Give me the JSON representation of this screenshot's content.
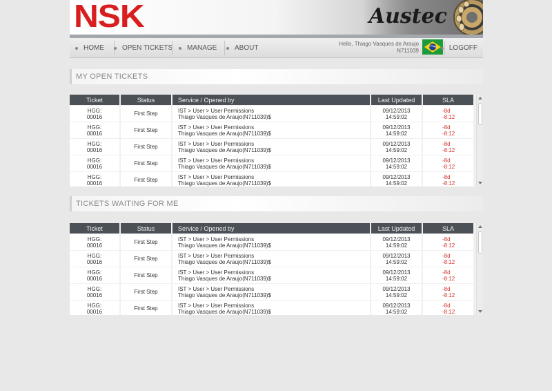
{
  "header": {
    "logo_text": "NSK",
    "brand_text": "Austec"
  },
  "nav": {
    "items": [
      {
        "label": "HOME"
      },
      {
        "label": "OPEN TICKETS"
      },
      {
        "label": "MANAGE"
      },
      {
        "label": "ABOUT"
      }
    ],
    "user_greeting": "Hello, Thiago Vasques de Araujo",
    "user_id": "N711039",
    "logoff_label": "LOGOFF"
  },
  "sections": [
    {
      "title": "MY OPEN TICKETS",
      "columns": [
        "Ticket",
        "Status",
        "Service / Opened by",
        "Last Updated",
        "SLA"
      ],
      "rows": [
        {
          "ticket_a": "HGG:",
          "ticket_b": "00016",
          "status": "First Step",
          "service": "IST > User > User Permissions",
          "opened_by": "Thiago Vasques de Araujo(N711039)$",
          "date": "09/12/2013",
          "time": "14:59:02",
          "sla_a": "-8d",
          "sla_b": "-8:12"
        },
        {
          "ticket_a": "HGG:",
          "ticket_b": "00016",
          "status": "First Step",
          "service": "IST > User > User Permissions",
          "opened_by": "Thiago Vasques de Araujo(N711039)$",
          "date": "09/12/2013",
          "time": "14:59:02",
          "sla_a": "-8d",
          "sla_b": "-8:12"
        },
        {
          "ticket_a": "HGG:",
          "ticket_b": "00016",
          "status": "First Step",
          "service": "IST > User > User Permissions",
          "opened_by": "Thiago Vasques de Araujo(N711039)$",
          "date": "09/12/2013",
          "time": "14:59:02",
          "sla_a": "-8d",
          "sla_b": "-8:12"
        },
        {
          "ticket_a": "HGG:",
          "ticket_b": "00016",
          "status": "First Step",
          "service": "IST > User > User Permissions",
          "opened_by": "Thiago Vasques de Araujo(N711039)$",
          "date": "09/12/2013",
          "time": "14:59:02",
          "sla_a": "-8d",
          "sla_b": "-8:12"
        },
        {
          "ticket_a": "HGG:",
          "ticket_b": "00016",
          "status": "First Step",
          "service": "IST > User > User Permissions",
          "opened_by": "Thiago Vasques de Araujo(N711039)$",
          "date": "09/12/2013",
          "time": "14:59:02",
          "sla_a": "-8d",
          "sla_b": "-8:12"
        }
      ]
    },
    {
      "title": "TICKETS WAITING FOR ME",
      "columns": [
        "Ticket",
        "Status",
        "Service / Opened by",
        "Last Updated",
        "SLA"
      ],
      "rows": [
        {
          "ticket_a": "HGG:",
          "ticket_b": "00016",
          "status": "First Step",
          "service": "IST > User > User Permissions",
          "opened_by": "Thiago Vasques de Araujo(N711039)$",
          "date": "09/12/2013",
          "time": "14:59:02",
          "sla_a": "-8d",
          "sla_b": "-8:12"
        },
        {
          "ticket_a": "HGG:",
          "ticket_b": "00016",
          "status": "First Step",
          "service": "IST > User > User Permissions",
          "opened_by": "Thiago Vasques de Araujo(N711039)$",
          "date": "09/12/2013",
          "time": "14:59:02",
          "sla_a": "-8d",
          "sla_b": "-8:12"
        },
        {
          "ticket_a": "HGG:",
          "ticket_b": "00016",
          "status": "First Step",
          "service": "IST > User > User Permissions",
          "opened_by": "Thiago Vasques de Araujo(N711039)$",
          "date": "09/12/2013",
          "time": "14:59:02",
          "sla_a": "-8d",
          "sla_b": "-8:12"
        },
        {
          "ticket_a": "HGG:",
          "ticket_b": "00016",
          "status": "First Step",
          "service": "IST > User > User Permissions",
          "opened_by": "Thiago Vasques de Araujo(N711039)$",
          "date": "09/12/2013",
          "time": "14:59:02",
          "sla_a": "-8d",
          "sla_b": "-8:12"
        },
        {
          "ticket_a": "HGG:",
          "ticket_b": "00016",
          "status": "First Step",
          "service": "IST > User > User Permissions",
          "opened_by": "Thiago Vasques de Araujo(N711039)$",
          "date": "09/12/2013",
          "time": "14:59:02",
          "sla_a": "-8d",
          "sla_b": "-8:12"
        }
      ]
    }
  ],
  "colors": {
    "logo_red": "#d81e1e",
    "table_header": "#4b5157",
    "sla_red": "#d0332f"
  }
}
